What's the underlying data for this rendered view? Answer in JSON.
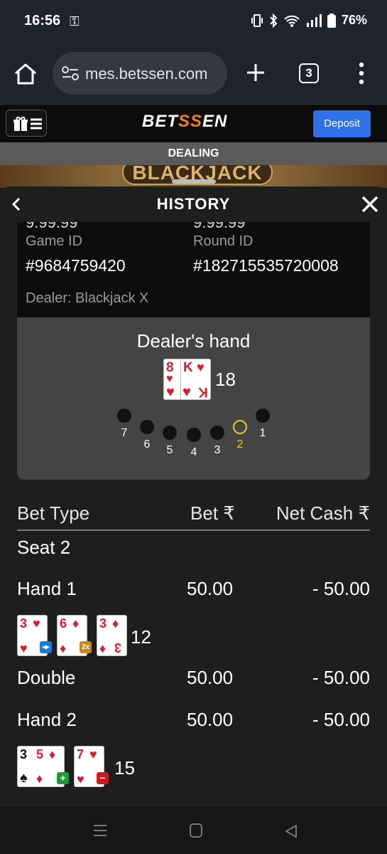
{
  "status_bar": {
    "time": "16:56",
    "battery": "76%"
  },
  "browser": {
    "url": "mes.betssen.com",
    "tab_count": "3"
  },
  "site": {
    "logo_prefix": "BET",
    "logo_mid": "SS",
    "logo_suffix": "EN",
    "deposit_label": "Deposit"
  },
  "game_status": "DEALING",
  "banner_title": "BLACKJACK",
  "history": {
    "title": "HISTORY",
    "cutoff_left": "9.99.99",
    "cutoff_right": "9.99.99",
    "game_id_label": "Game ID",
    "game_id": "#9684759420",
    "round_id_label": "Round ID",
    "round_id": "#182715535720008",
    "dealer_label": "Dealer: Blackjack X",
    "dealer_hand": {
      "title": "Dealer's hand",
      "cards": [
        {
          "rank": "8",
          "suit": "♥"
        },
        {
          "rank": "K",
          "suit": "♥"
        }
      ],
      "total": "18"
    },
    "seats": [
      "7",
      "6",
      "5",
      "4",
      "3",
      "2",
      "1"
    ],
    "active_seat": "2",
    "table": {
      "col_bet_type": "Bet Type",
      "col_bet": "Bet ₹",
      "col_net": "Net Cash ₹",
      "seat_label": "Seat 2",
      "rows": [
        {
          "type": "Hand 1",
          "bet": "50.00",
          "net": "- 50.00"
        },
        {
          "type": "Double",
          "bet": "50.00",
          "net": "- 50.00"
        },
        {
          "type": "Hand 2",
          "bet": "50.00",
          "net": "- 50.00"
        }
      ],
      "hand1": {
        "cards": [
          {
            "rank": "3",
            "suit": "♥"
          },
          {
            "rank": "6",
            "suit": "♦"
          },
          {
            "rank": "3",
            "suit": "♦"
          }
        ],
        "badges": [
          "split-icon",
          "2x"
        ],
        "total": "12"
      },
      "hand2": {
        "cards": [
          {
            "rank": "3",
            "suit": "♠"
          },
          {
            "rank": "5",
            "suit": "♦"
          },
          {
            "rank": "7",
            "suit": "♥"
          }
        ],
        "badges": [
          "+",
          "−"
        ],
        "total": "15"
      }
    }
  },
  "colors": {
    "accent_orange": "#f07d14",
    "deposit_blue": "#2f6fe8",
    "active_seat": "#f0c419",
    "card_red": "#e2182b"
  }
}
